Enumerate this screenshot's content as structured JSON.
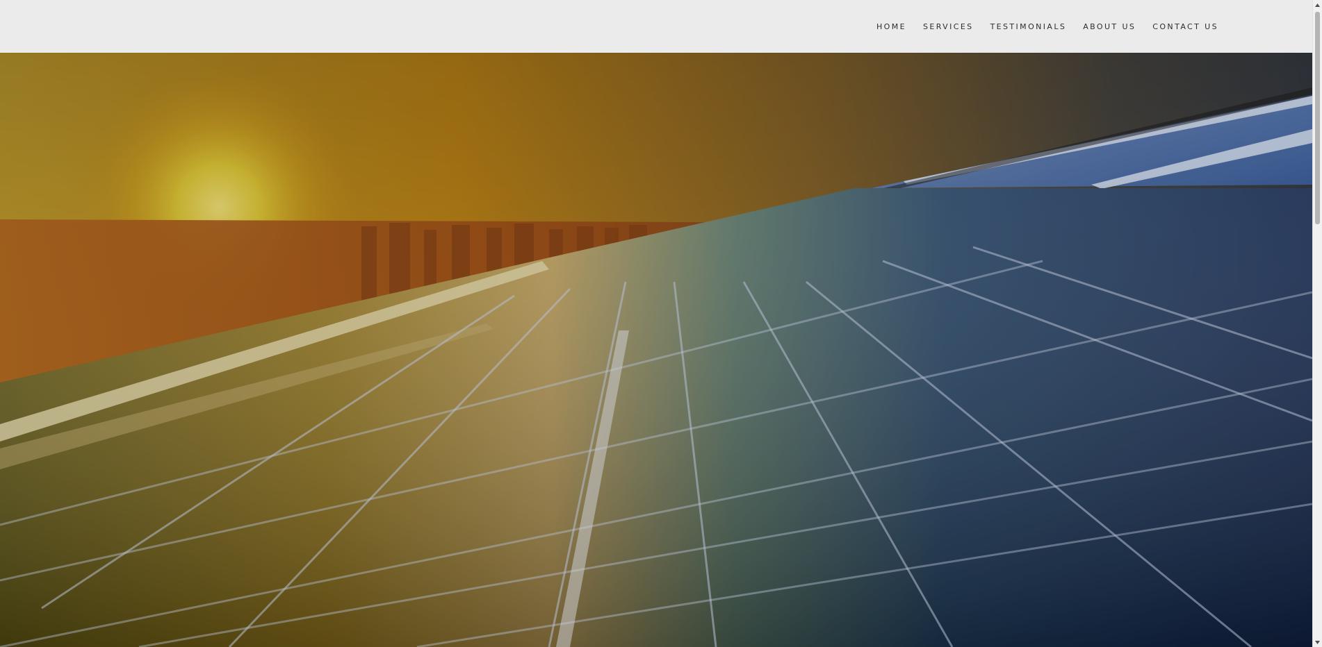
{
  "nav": {
    "items": [
      {
        "label": "HOME"
      },
      {
        "label": "SERVICES"
      },
      {
        "label": "TESTIMONIALS"
      },
      {
        "label": "ABOUT US"
      },
      {
        "label": "CONTACT US"
      }
    ]
  },
  "hero": {
    "image": "solar-panels-sunset-photo"
  },
  "colors": {
    "header_bg": "#ebebeb",
    "nav_text": "#2d2d2d",
    "sun": "#f2d43a",
    "panel_blue": "#1f3a73"
  }
}
